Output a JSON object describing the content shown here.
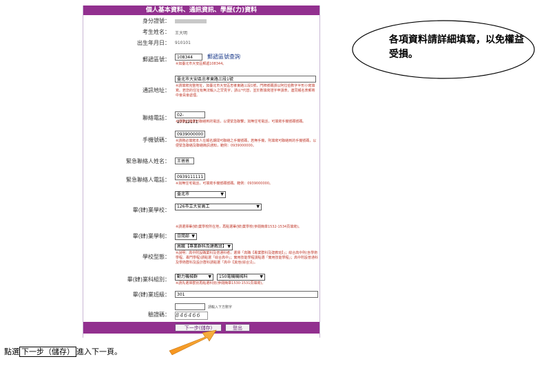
{
  "form": {
    "title": "個人基本資料、通訊資訊、學歷(力)資料",
    "fields": {
      "id_label": "身分證號：",
      "name_label": "考生姓名：",
      "name_value": "王大明",
      "birth_label": "出生年月日：",
      "birth_value": "910101",
      "postal_label": "郵遞區號：",
      "postal_value": "108344",
      "postal_button": "郵遞區號查詢",
      "postal_note": "※如臺北市大安區郵遞108344。",
      "address_label": "通訊地址：",
      "address_value": "臺北市大安區忠孝東路三段1號",
      "address_note": "※請填寫完整地址，如臺北市大安區忠孝東路三段1號，門牌號碼請以阿拉伯數字半形小寫填寫。若您的住址有無法輸入之罕見字，請以*代替，並於數填寫證字申請表，連同報名表郵寄中會員會處理。",
      "phone_label": "聯絡電話：",
      "phone_value": "02-27712171",
      "phone_note": "※請務必填寫可聯絡到的電話，以便緊急聯繫；如無住宅電話，可填寫手機號碼號碼。",
      "mobile_label": "手機號碼：",
      "mobile_value": "0939000000",
      "mobile_note": "※請務必填寫本人在報名期間可聯絡之手機號碼，若無手機，則填寫可聯絡到的手機號碼，以便緊急聯絡及聯絡簡訊通知，範例：0939000000。",
      "emergency_name_label": "緊急聯絡人姓名：",
      "emergency_name_value": "王爸爸",
      "emergency_phone_label": "緊急聯絡人電話：",
      "emergency_phone_value": "0939111111",
      "emergency_phone_note": "※如無住宅電話，可填寫手機號碼號碼。範例：0939000000。",
      "school_label": "畢(肄)業學校：",
      "school_city": "臺北市",
      "school_name": "126市立大安高工",
      "school_note": "※請選擇畢(肄)業學校所在地，再點選畢(肄)業學校(參閱簡章1532-1534頁填寫)。",
      "year_label": "畢(肄)業學制：",
      "year_value": "日間部",
      "type_label": "學校型態：",
      "type_value": "高職【專業群科及建教班】",
      "type_note": "※說明：高中附設職業科及普通科者，選擇「高職【專業群科及建教班】」；綜合高中則(含學術學程、專門學程)請點選「綜合高中」；實用技能學程請點選「實用技能學程」；高中附設普通科及學術群科及設計群科請點選「高中【其他(綜合)】」。",
      "dept_label": "畢(肄)業科組別：",
      "dept_group": "動力機械群",
      "dept_value": "150電機機械科",
      "dept_note": "※請先選擇群別再點選科別(參閱簡章1530-1531頁填寫)。",
      "class_label": "畢(肄)業班級：",
      "class_value": "301",
      "captcha_label": "驗證碼：",
      "captcha_hint": "請輸入下方數字",
      "captcha_digits": "846466"
    },
    "buttons": {
      "next_save": "下一步(儲存)",
      "logout": "登出"
    }
  },
  "callout": {
    "text": "各項資料請詳細填寫，以免權益受損。"
  },
  "instruction": {
    "prefix": "點選",
    "boxed": "下一步（儲存）",
    "suffix": "進入下一頁。"
  },
  "colors": {
    "header": "#92308f",
    "note": "#c0392b",
    "arrow": "#f7941d"
  }
}
